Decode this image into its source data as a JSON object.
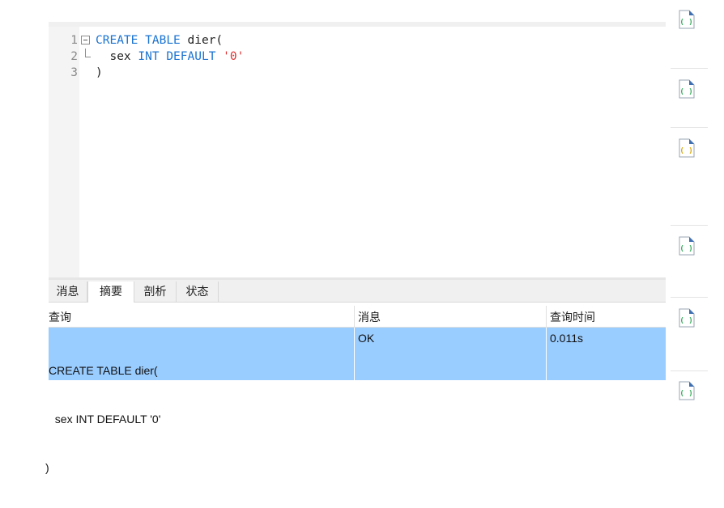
{
  "editor": {
    "lines": [
      {
        "num": "1",
        "parts": [
          [
            "kw",
            "CREATE"
          ],
          [
            "t",
            " "
          ],
          [
            "kw",
            "TABLE"
          ],
          [
            "t",
            " dier("
          ]
        ]
      },
      {
        "num": "2",
        "parts": [
          [
            "t",
            "  sex "
          ],
          [
            "kw",
            "INT"
          ],
          [
            "t",
            " "
          ],
          [
            "kw",
            "DEFAULT"
          ],
          [
            "t",
            " "
          ],
          [
            "str",
            "'0'"
          ]
        ]
      },
      {
        "num": "3",
        "parts": [
          [
            "t",
            ")"
          ]
        ]
      }
    ]
  },
  "tabs": [
    "消息",
    "摘要",
    "剖析",
    "状态"
  ],
  "active_tab": "摘要",
  "results": {
    "columns": [
      "查询",
      "消息",
      "查询时间"
    ],
    "row": {
      "query_lines": [
        "CREATE TABLE dier(",
        "  sex INT DEFAULT '0'",
        ")"
      ],
      "message": "OK",
      "time": "0.011s"
    }
  },
  "sidebar_icons": [
    {
      "name": "sql-file-icon",
      "accent": "#2eaa55"
    },
    {
      "name": "sql-file-icon",
      "accent": "#2eaa55"
    },
    {
      "name": "sql-file-icon",
      "accent": "#d9a400"
    },
    {
      "name": "sql-file-icon",
      "accent": "#2eaa55"
    },
    {
      "name": "sql-file-icon",
      "accent": "#2eaa55"
    },
    {
      "name": "sql-file-icon",
      "accent": "#2eaa55"
    }
  ],
  "colors": {
    "keyword": "#1a73d1",
    "string": "#e03030",
    "selection": "#99ccff"
  }
}
